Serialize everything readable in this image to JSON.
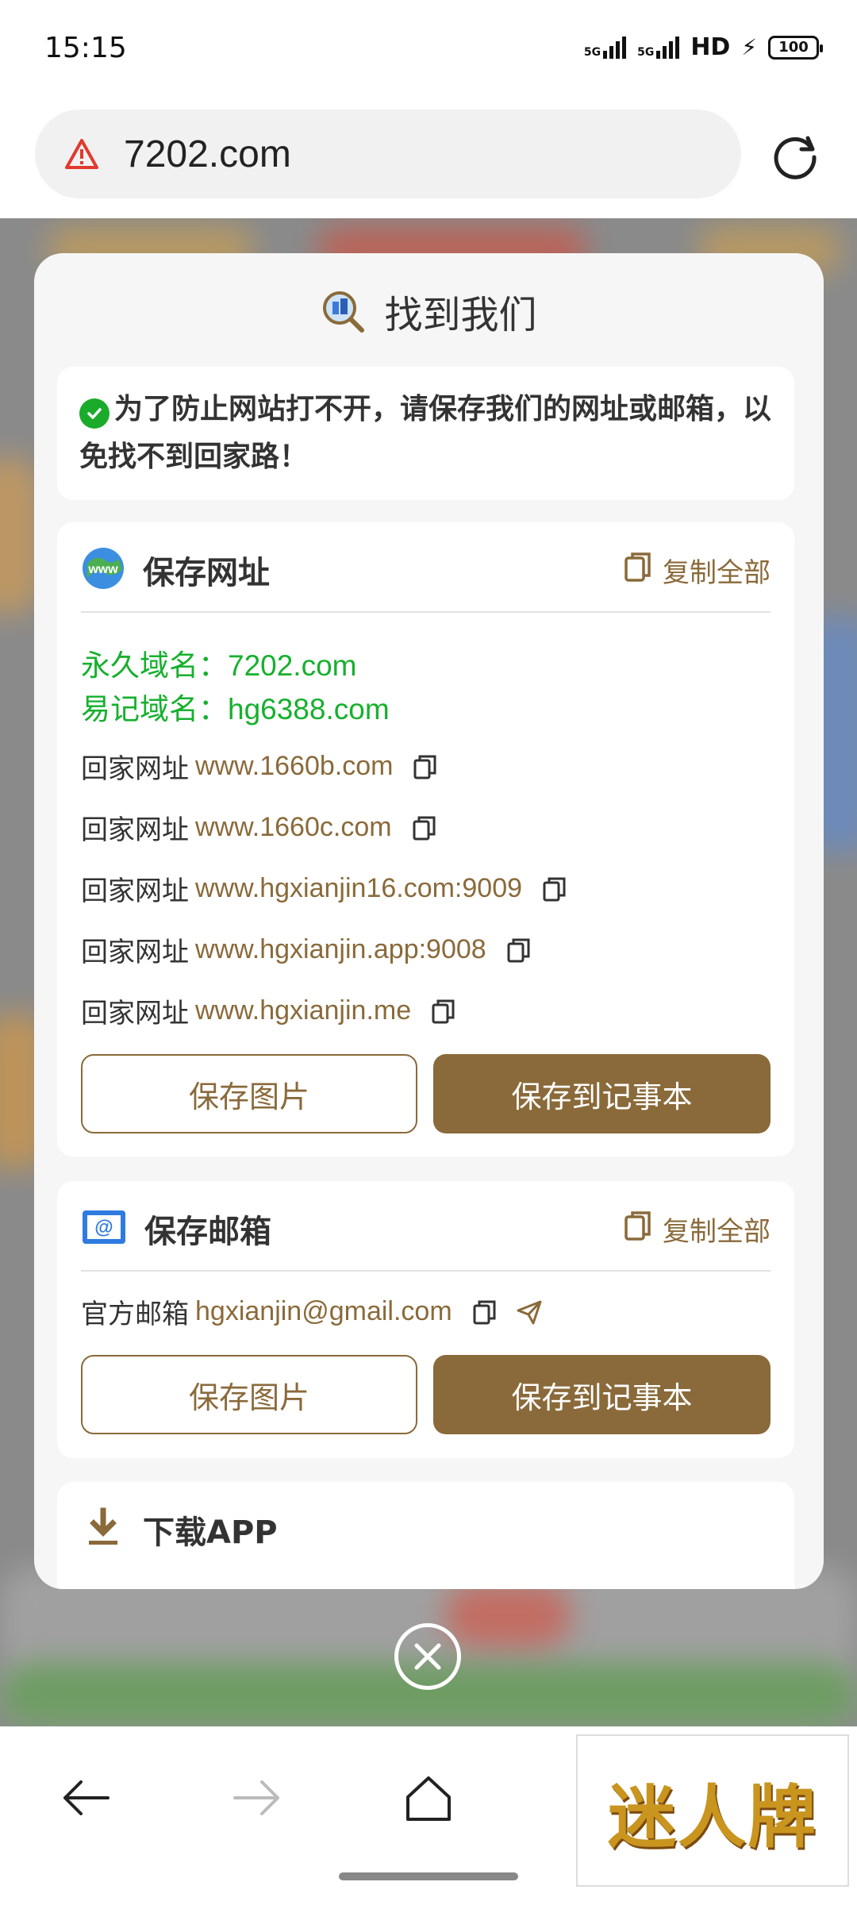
{
  "status_bar": {
    "time": "15:15",
    "signal1": "5G",
    "signal2": "5G",
    "hd": "HD",
    "battery": "100"
  },
  "browser": {
    "url": "7202.com"
  },
  "modal": {
    "title": "找到我们",
    "notice": "为了防止网站打不开，请保存我们的网址或邮箱，以免找不到回家路！",
    "urls_section": {
      "title": "保存网址",
      "copy_all": "复制全部",
      "permanent_label": "永久域名：",
      "permanent_value": "7202.com",
      "easy_label": "易记域名：",
      "easy_value": "hg6388.com",
      "links": [
        {
          "label": "回家网址",
          "value": "www.1660b.com"
        },
        {
          "label": "回家网址",
          "value": "www.1660c.com"
        },
        {
          "label": "回家网址",
          "value": "www.hgxianjin16.com:9009"
        },
        {
          "label": "回家网址",
          "value": "www.hgxianjin.app:9008"
        },
        {
          "label": "回家网址",
          "value": "www.hgxianjin.me"
        }
      ],
      "save_image": "保存图片",
      "save_notes": "保存到记事本"
    },
    "mail_section": {
      "title": "保存邮箱",
      "copy_all": "复制全部",
      "label": "官方邮箱",
      "value": "hgxianjin@gmail.com",
      "save_image": "保存图片",
      "save_notes": "保存到记事本"
    },
    "app_section": {
      "title": "下载APP"
    }
  },
  "ad": {
    "text": "迷人牌"
  },
  "colors": {
    "accent": "#8a6a3a",
    "green": "#17b02e",
    "modal_bg": "#f6f6f6"
  },
  "icons": [
    "warning-icon",
    "reload-icon",
    "search-building-icon",
    "check-icon",
    "globe-www-icon",
    "copy-icon",
    "mail-icon",
    "send-icon",
    "download-icon",
    "close-icon",
    "back-icon",
    "forward-icon",
    "home-icon"
  ]
}
